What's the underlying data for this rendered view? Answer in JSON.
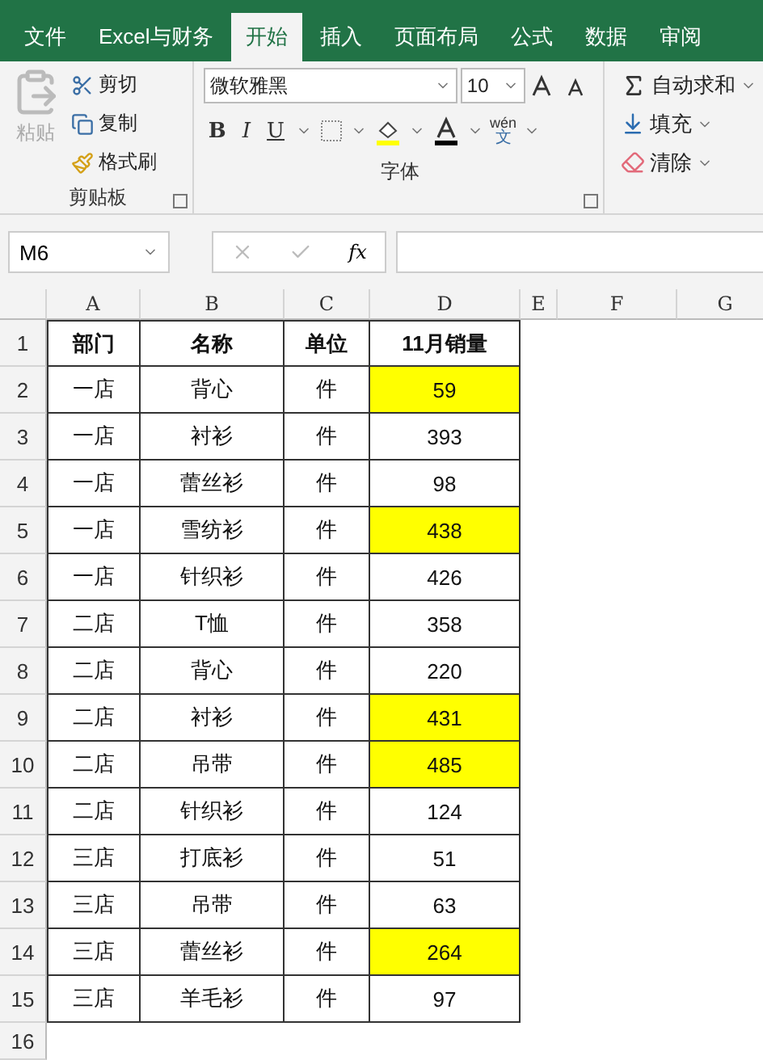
{
  "tabs": [
    {
      "label": "文件",
      "selected": false
    },
    {
      "label": "Excel与财务",
      "selected": false
    },
    {
      "label": "开始",
      "selected": true
    },
    {
      "label": "插入",
      "selected": false
    },
    {
      "label": "页面布局",
      "selected": false
    },
    {
      "label": "公式",
      "selected": false
    },
    {
      "label": "数据",
      "selected": false
    },
    {
      "label": "审阅",
      "selected": false
    }
  ],
  "clipboard": {
    "paste": "粘贴",
    "cut": "剪切",
    "copy": "复制",
    "format_painter": "格式刷",
    "label": "剪贴板"
  },
  "font": {
    "name": "微软雅黑",
    "size": "10",
    "bold": "B",
    "italic": "I",
    "underline": "U",
    "phonetic_top": "wén",
    "phonetic_bottom": "文",
    "label": "字体"
  },
  "editing": {
    "autosum": "自动求和",
    "fill": "填充",
    "clear": "清除"
  },
  "name_box": "M6",
  "fx": "fx",
  "columns": [
    "A",
    "B",
    "C",
    "D",
    "E",
    "F",
    "G"
  ],
  "header_row": {
    "number": "1",
    "cells": [
      "部门",
      "名称",
      "单位",
      "11月销量"
    ]
  },
  "rows": [
    {
      "number": "2",
      "cells": [
        {
          "text": "一店",
          "highlighted": false
        },
        {
          "text": "背心",
          "highlighted": false
        },
        {
          "text": "件",
          "highlighted": false
        },
        {
          "text": "59",
          "highlighted": true
        }
      ]
    },
    {
      "number": "3",
      "cells": [
        {
          "text": "一店",
          "highlighted": false
        },
        {
          "text": "衬衫",
          "highlighted": false
        },
        {
          "text": "件",
          "highlighted": false
        },
        {
          "text": "393",
          "highlighted": false
        }
      ]
    },
    {
      "number": "4",
      "cells": [
        {
          "text": "一店",
          "highlighted": false
        },
        {
          "text": "蕾丝衫",
          "highlighted": false
        },
        {
          "text": "件",
          "highlighted": false
        },
        {
          "text": "98",
          "highlighted": false
        }
      ]
    },
    {
      "number": "5",
      "cells": [
        {
          "text": "一店",
          "highlighted": false
        },
        {
          "text": "雪纺衫",
          "highlighted": false
        },
        {
          "text": "件",
          "highlighted": false
        },
        {
          "text": "438",
          "highlighted": true
        }
      ]
    },
    {
      "number": "6",
      "cells": [
        {
          "text": "一店",
          "highlighted": false
        },
        {
          "text": "针织衫",
          "highlighted": false
        },
        {
          "text": "件",
          "highlighted": false
        },
        {
          "text": "426",
          "highlighted": false
        }
      ]
    },
    {
      "number": "7",
      "cells": [
        {
          "text": "二店",
          "highlighted": false
        },
        {
          "text": "T恤",
          "highlighted": false
        },
        {
          "text": "件",
          "highlighted": false
        },
        {
          "text": "358",
          "highlighted": false
        }
      ]
    },
    {
      "number": "8",
      "cells": [
        {
          "text": "二店",
          "highlighted": false
        },
        {
          "text": "背心",
          "highlighted": false
        },
        {
          "text": "件",
          "highlighted": false
        },
        {
          "text": "220",
          "highlighted": false
        }
      ]
    },
    {
      "number": "9",
      "cells": [
        {
          "text": "二店",
          "highlighted": false
        },
        {
          "text": "衬衫",
          "highlighted": false
        },
        {
          "text": "件",
          "highlighted": false
        },
        {
          "text": "431",
          "highlighted": true
        }
      ]
    },
    {
      "number": "10",
      "cells": [
        {
          "text": "二店",
          "highlighted": false
        },
        {
          "text": "吊带",
          "highlighted": false
        },
        {
          "text": "件",
          "highlighted": false
        },
        {
          "text": "485",
          "highlighted": true
        }
      ]
    },
    {
      "number": "11",
      "cells": [
        {
          "text": "二店",
          "highlighted": false
        },
        {
          "text": "针织衫",
          "highlighted": false
        },
        {
          "text": "件",
          "highlighted": false
        },
        {
          "text": "124",
          "highlighted": false
        }
      ]
    },
    {
      "number": "12",
      "cells": [
        {
          "text": "三店",
          "highlighted": false
        },
        {
          "text": "打底衫",
          "highlighted": false
        },
        {
          "text": "件",
          "highlighted": false
        },
        {
          "text": "51",
          "highlighted": false
        }
      ]
    },
    {
      "number": "13",
      "cells": [
        {
          "text": "三店",
          "highlighted": false
        },
        {
          "text": "吊带",
          "highlighted": false
        },
        {
          "text": "件",
          "highlighted": false
        },
        {
          "text": "63",
          "highlighted": false
        }
      ]
    },
    {
      "number": "14",
      "cells": [
        {
          "text": "三店",
          "highlighted": false
        },
        {
          "text": "蕾丝衫",
          "highlighted": false
        },
        {
          "text": "件",
          "highlighted": false
        },
        {
          "text": "264",
          "highlighted": true
        }
      ]
    },
    {
      "number": "15",
      "cells": [
        {
          "text": "三店",
          "highlighted": false
        },
        {
          "text": "羊毛衫",
          "highlighted": false
        },
        {
          "text": "件",
          "highlighted": false
        },
        {
          "text": "97",
          "highlighted": false
        }
      ]
    },
    {
      "number": "16",
      "cells": []
    }
  ]
}
